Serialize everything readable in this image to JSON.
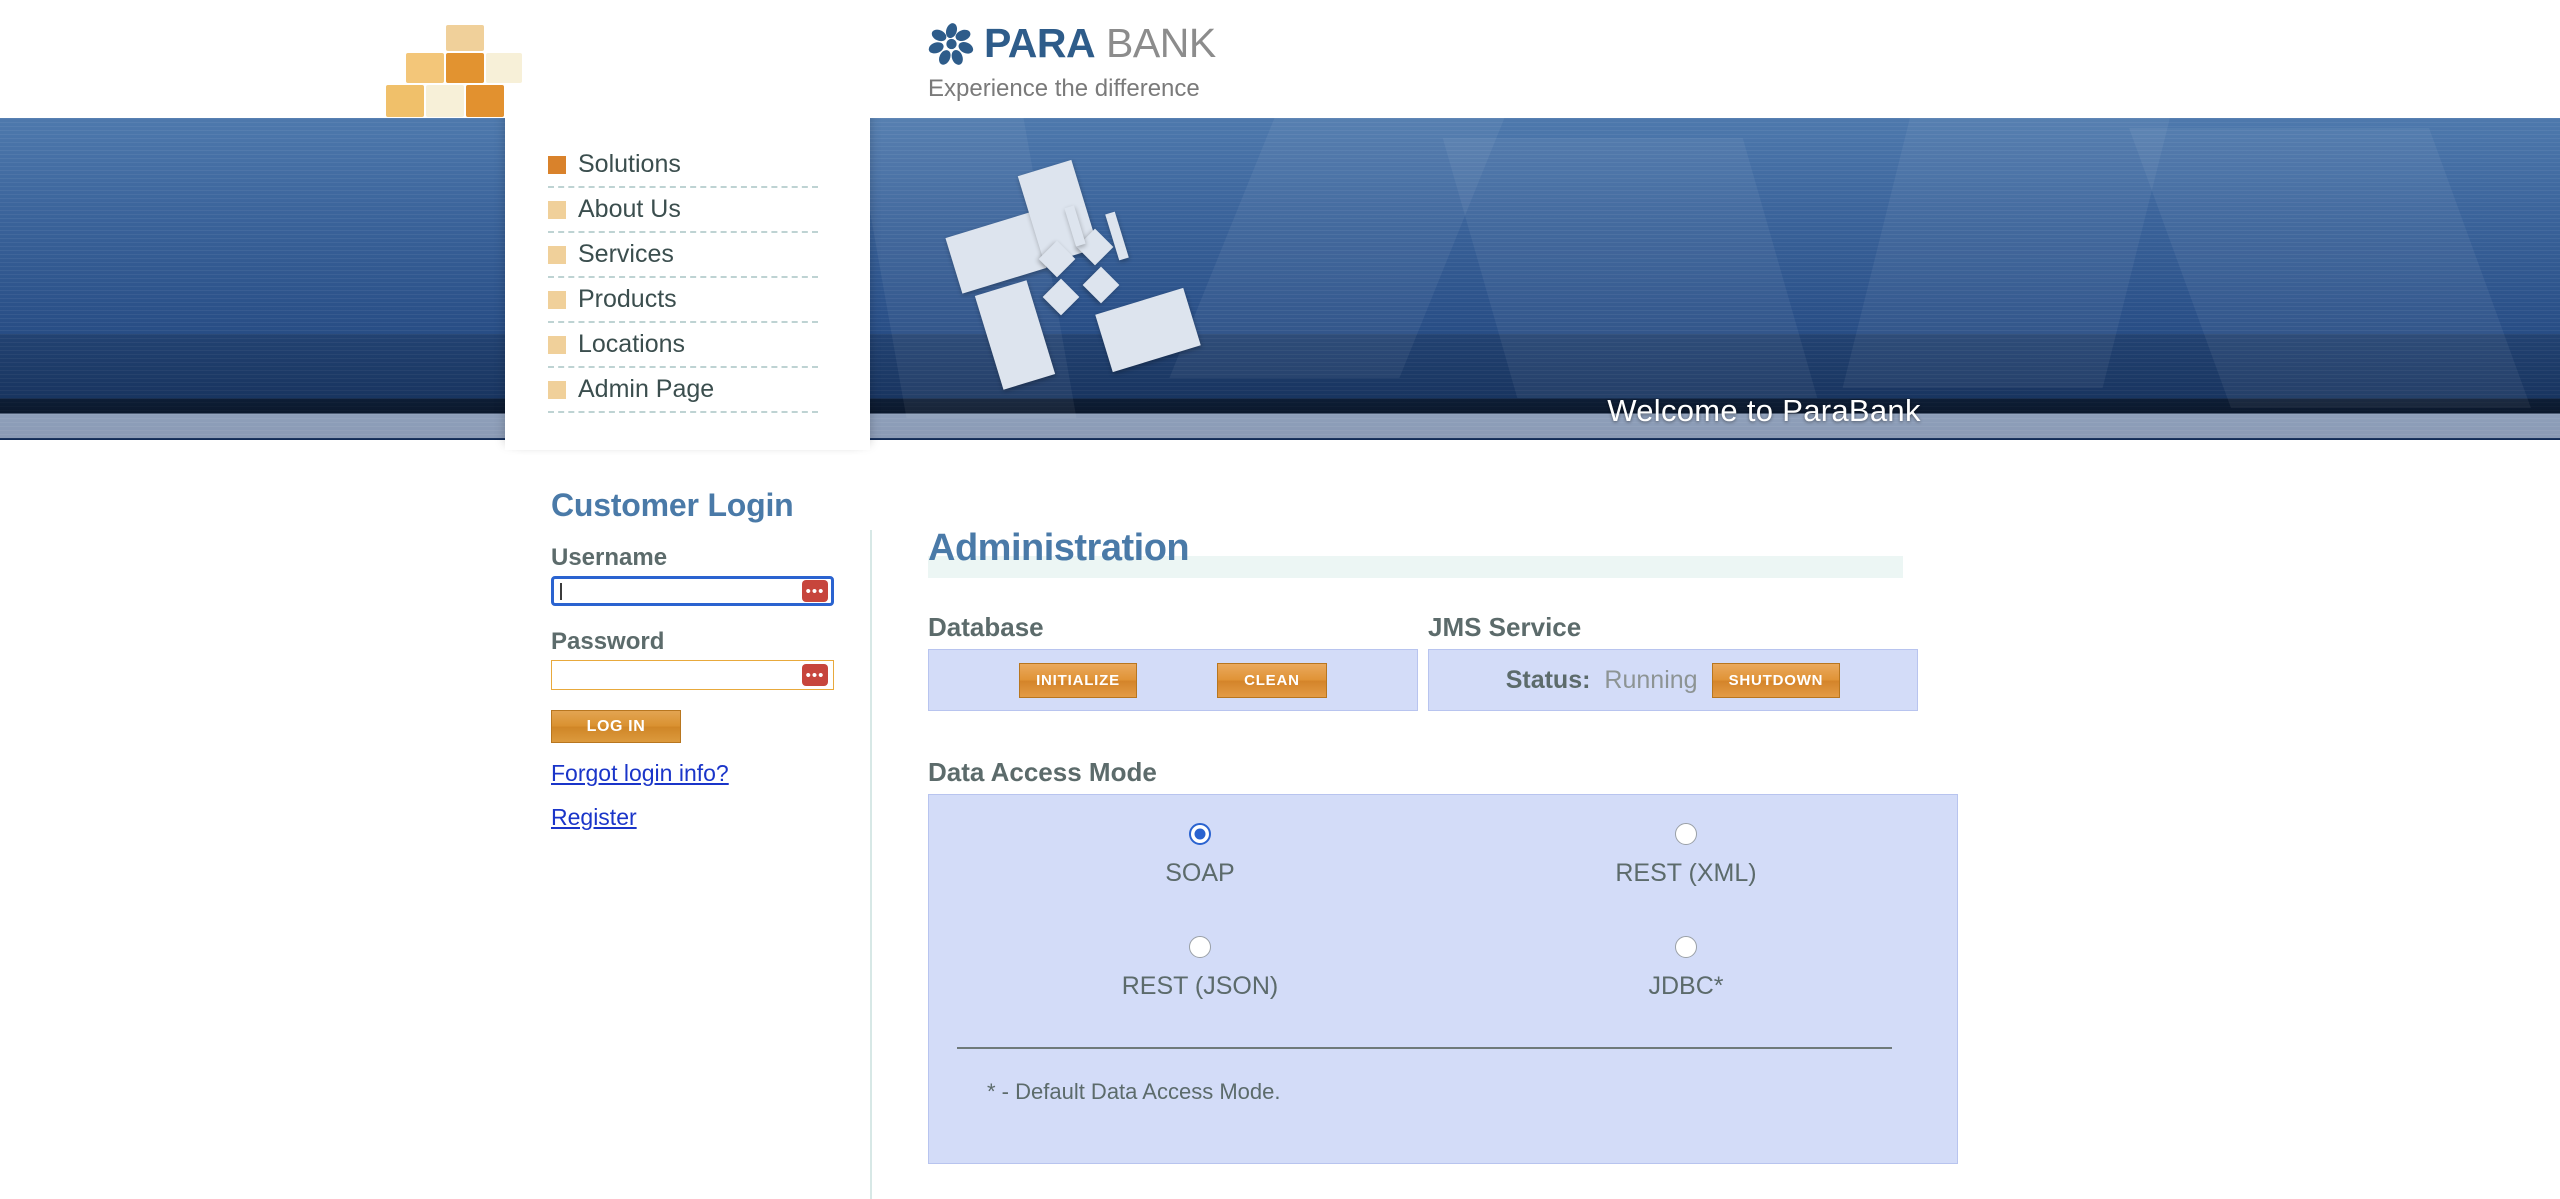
{
  "brand": {
    "logo_para": "PARA",
    "logo_bank": " BANK",
    "tagline": "Experience the difference"
  },
  "banner": {
    "welcome": "Welcome to ParaBank",
    "quick_icons": [
      {
        "name": "home-icon",
        "title": "Home"
      },
      {
        "name": "about-us-people-icon",
        "title": "About Us"
      },
      {
        "name": "contact-envelope-icon",
        "title": "Contact"
      }
    ]
  },
  "sidebar": {
    "items": [
      {
        "label": "Solutions",
        "active": true
      },
      {
        "label": "About Us",
        "active": false
      },
      {
        "label": "Services",
        "active": false
      },
      {
        "label": "Products",
        "active": false
      },
      {
        "label": "Locations",
        "active": false
      },
      {
        "label": "Admin Page",
        "active": false
      }
    ]
  },
  "login": {
    "heading": "Customer Login",
    "username_label": "Username",
    "username_value": "",
    "username_placeholder": "",
    "password_label": "Password",
    "password_value": "",
    "password_placeholder": "",
    "submit_label": "LOG IN",
    "forgot_link": "Forgot login info?",
    "register_link": "Register",
    "badge_glyph": "•••"
  },
  "main": {
    "title": "Administration",
    "database": {
      "heading": "Database",
      "initialize_label": "INITIALIZE",
      "clean_label": "CLEAN"
    },
    "jms": {
      "heading": "JMS Service",
      "status_label": "Status:",
      "status_value": "Running",
      "shutdown_label": "SHUTDOWN"
    },
    "data_access_mode": {
      "heading": "Data Access Mode",
      "options": [
        {
          "label": "SOAP",
          "selected": true
        },
        {
          "label": "REST (XML)",
          "selected": false
        },
        {
          "label": "REST (JSON)",
          "selected": false
        },
        {
          "label": "JDBC*",
          "selected": false
        }
      ],
      "note": "* - Default Data Access Mode."
    }
  },
  "colors": {
    "brand_blue": "#2E5C8A",
    "brand_gray": "#8C8C8C",
    "accent_orange": "#d9822b",
    "panel_blue": "#d3dcf8",
    "heading_blue": "#4a7aa8",
    "label_gray": "#5c6b6b",
    "link_blue": "#1a35c9",
    "radio_selected": "#2a63d0"
  }
}
